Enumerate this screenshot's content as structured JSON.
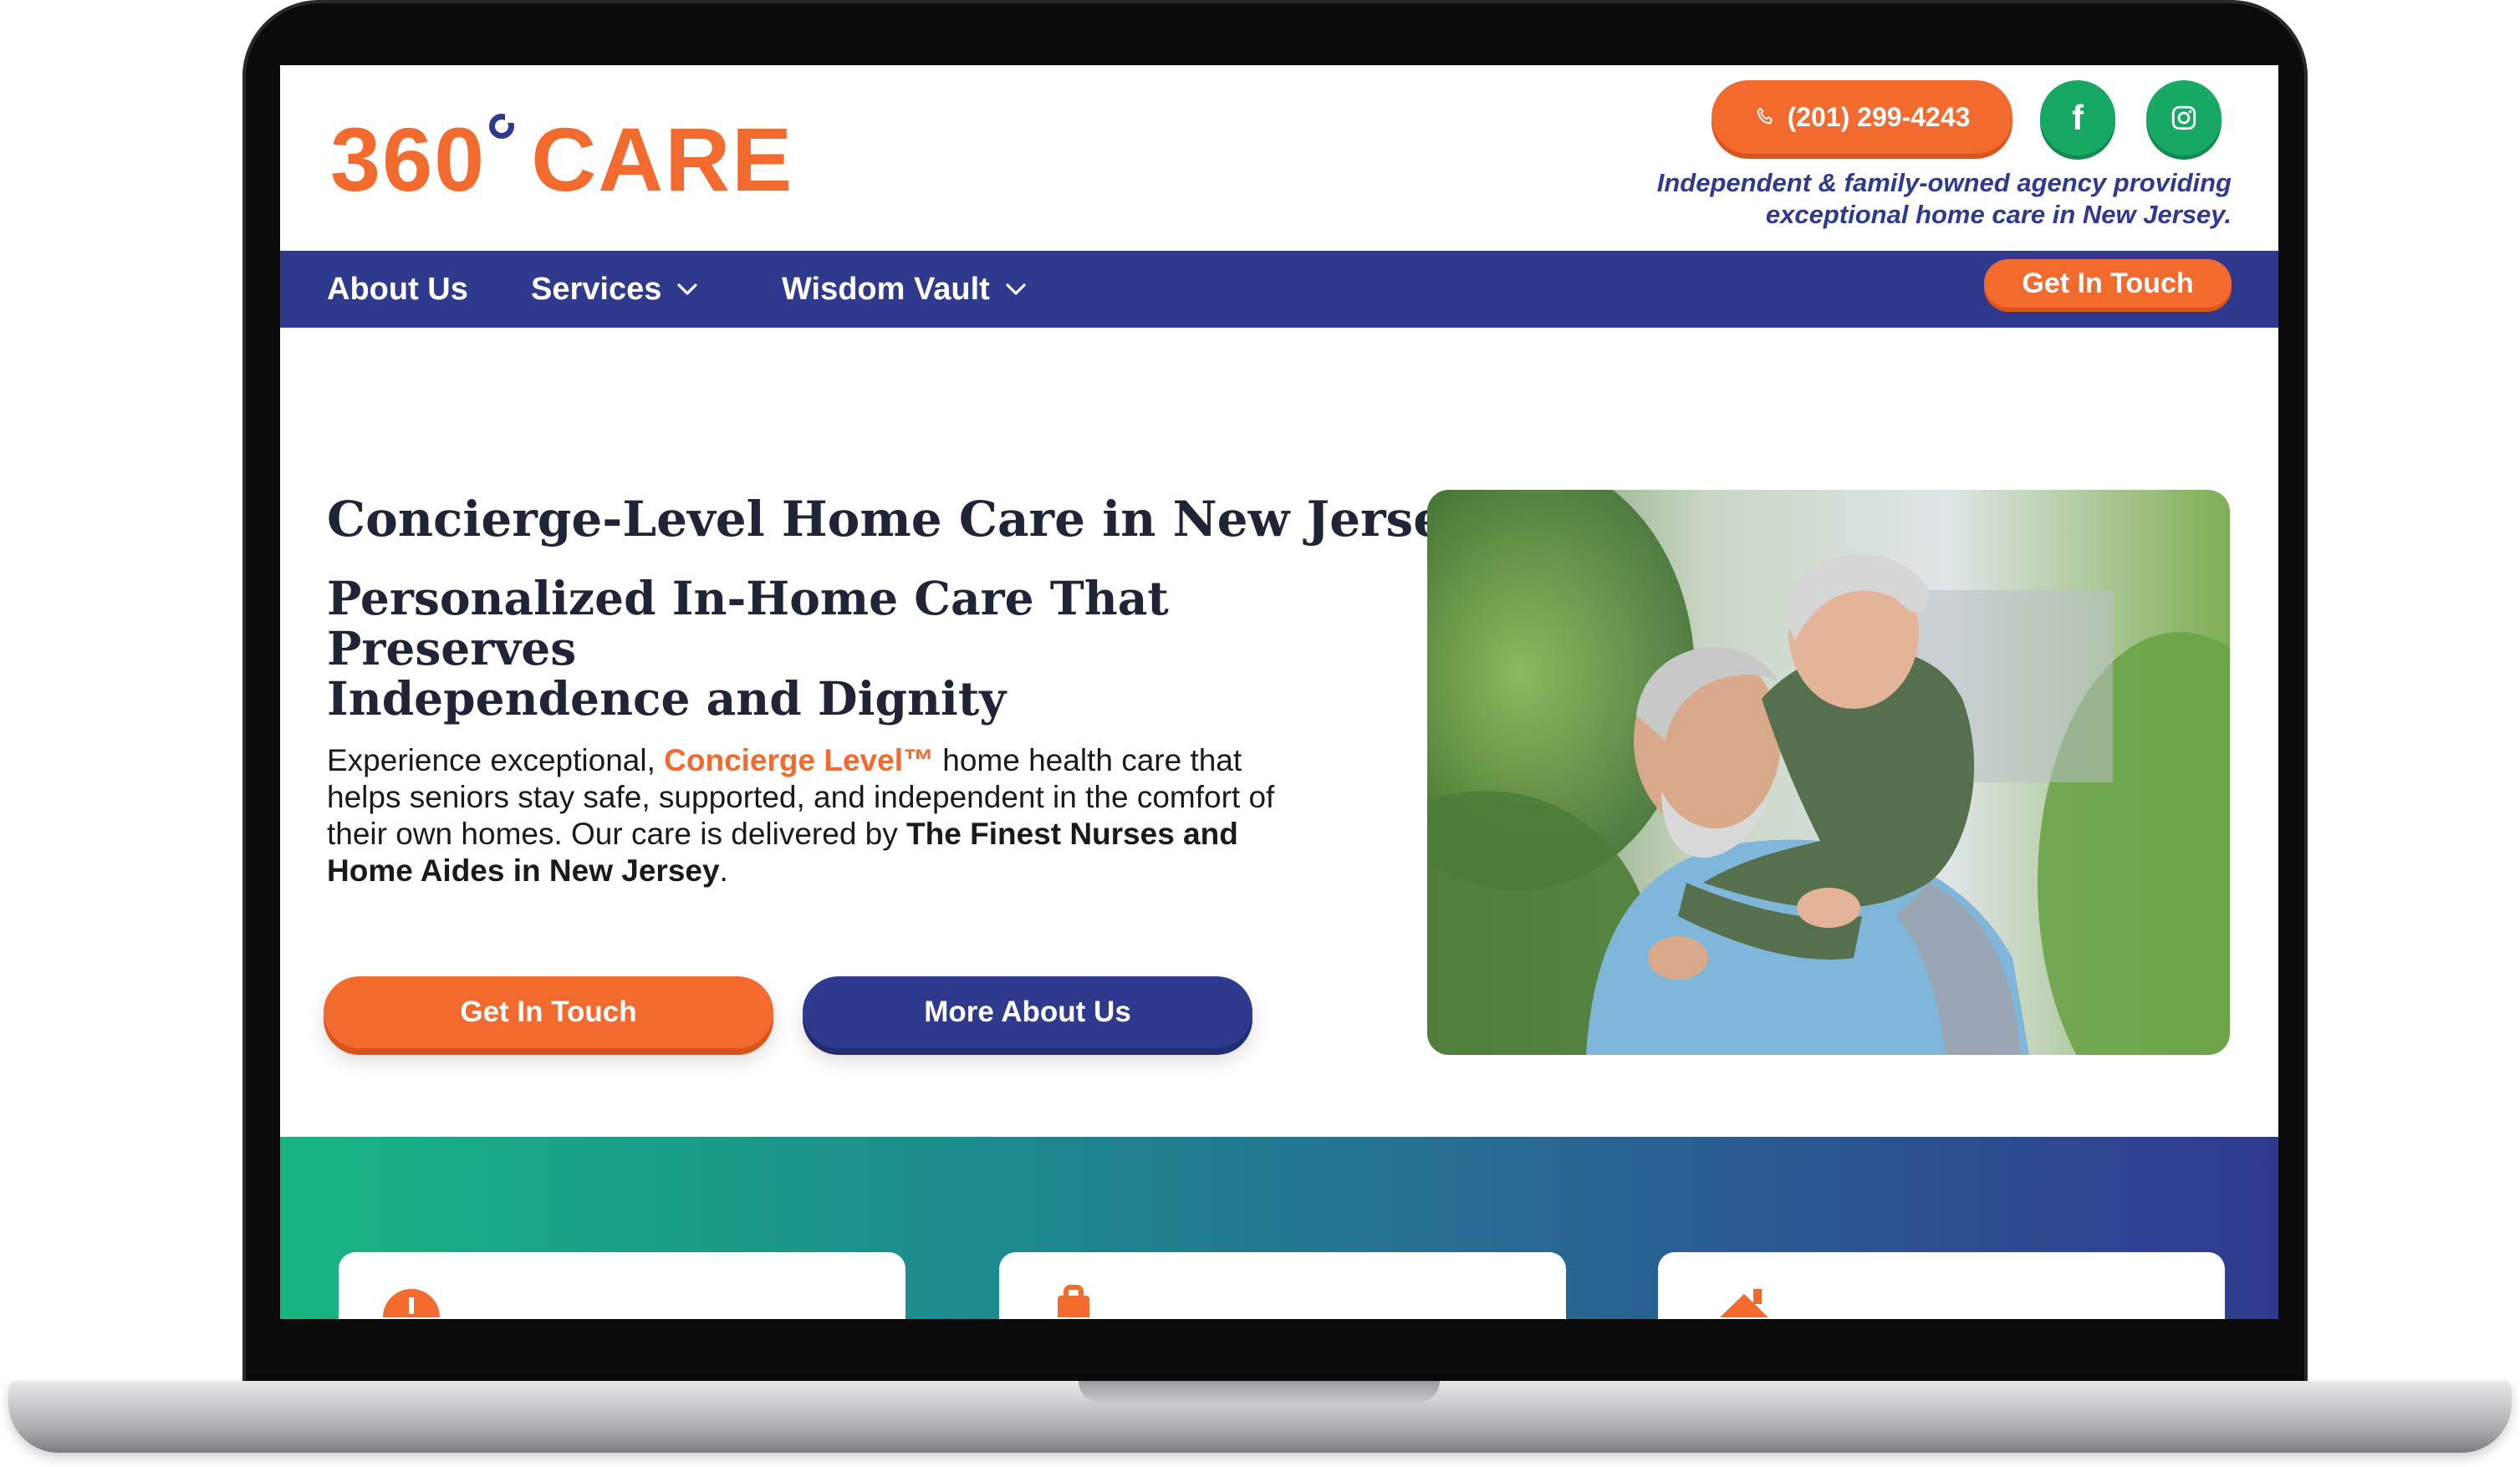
{
  "site": {
    "logo_number": "360",
    "logo_word": "CARE",
    "phone_label": "(201) 299-4243",
    "tagline_line1": "Independent & family-owned agency providing",
    "tagline_line2": "exceptional home care in New Jersey."
  },
  "social": [
    {
      "icon": "facebook-icon",
      "glyph": "f"
    },
    {
      "icon": "instagram-icon"
    }
  ],
  "nav": {
    "items": [
      {
        "label": "About Us",
        "has_dropdown": false
      },
      {
        "label": "Services",
        "has_dropdown": true
      },
      {
        "label": "Wisdom Vault",
        "has_dropdown": true
      }
    ],
    "cta_label": "Get In Touch"
  },
  "hero": {
    "title": "Concierge-Level Home Care in New Jersey",
    "subtitle_line1": "Personalized In-Home Care That Preserves",
    "subtitle_line2": "Independence and Dignity",
    "body_prefix": "Experience exceptional,",
    "body_accent": "Concierge Level™",
    "body_mid": "home health care that helps seniors stay safe, supported, and independent in the comfort of their own homes. Our care is delivered by",
    "body_bold": "The Finest Nurses and Home Aides in New Jersey",
    "body_end": ".",
    "primary_button": "Get In Touch",
    "secondary_button": "More About Us"
  },
  "colors": {
    "brand_orange": "#f26a2e",
    "brand_navy": "#2f3a8f",
    "brand_green": "#17a864"
  }
}
